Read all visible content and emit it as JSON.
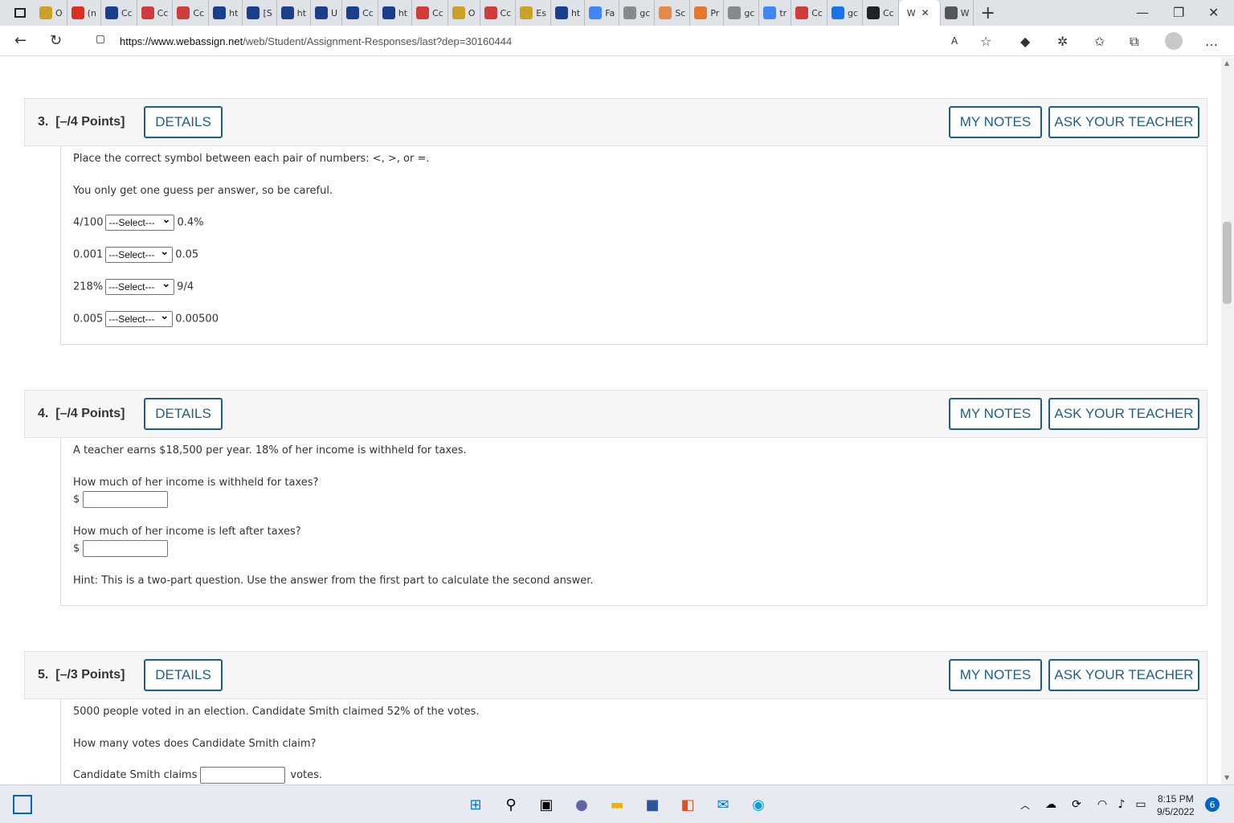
{
  "browser": {
    "tabs": [
      {
        "short": "O",
        "icon": "yellow-circle-icon",
        "color": "#c9a227"
      },
      {
        "short": "(n",
        "icon": "gmail-icon",
        "color": "#d93025"
      },
      {
        "short": "Cc",
        "icon": "star-icon",
        "color": "#1a3f8c"
      },
      {
        "short": "Cc",
        "icon": "pdf-icon",
        "color": "#d03c3c"
      },
      {
        "short": "Cc",
        "icon": "pdf-icon",
        "color": "#d03c3c"
      },
      {
        "short": "ht",
        "icon": "star-icon",
        "color": "#1a3f8c"
      },
      {
        "short": "[S",
        "icon": "star-icon",
        "color": "#1a3f8c"
      },
      {
        "short": "ht",
        "icon": "star-icon",
        "color": "#1a3f8c"
      },
      {
        "short": "U",
        "icon": "star-icon",
        "color": "#1a3f8c"
      },
      {
        "short": "Cc",
        "icon": "star-icon",
        "color": "#1a3f8c"
      },
      {
        "short": "ht",
        "icon": "star-icon",
        "color": "#1a3f8c"
      },
      {
        "short": "Cc",
        "icon": "pdf-icon",
        "color": "#d03c3c"
      },
      {
        "short": "O",
        "icon": "yellow-circle-icon",
        "color": "#c9a227"
      },
      {
        "short": "Cc",
        "icon": "pdf-icon",
        "color": "#d03c3c"
      },
      {
        "short": "Es",
        "icon": "yellow-circle-icon",
        "color": "#c9a227"
      },
      {
        "short": "ht",
        "icon": "star-icon",
        "color": "#1a3f8c"
      },
      {
        "short": "Fa",
        "icon": "doc-icon",
        "color": "#4285f4"
      },
      {
        "short": "gc",
        "icon": "search-icon",
        "color": "#888888"
      },
      {
        "short": "Sc",
        "icon": "c-icon",
        "color": "#e08a4c"
      },
      {
        "short": "Pr",
        "icon": "face-icon",
        "color": "#e8772e"
      },
      {
        "short": "gc",
        "icon": "search-icon",
        "color": "#888888"
      },
      {
        "short": "tr",
        "icon": "google-icon",
        "color": "#4285f4"
      },
      {
        "short": "Cc",
        "icon": "pdf-icon",
        "color": "#d03c3c"
      },
      {
        "short": "gc",
        "icon": "search-icon",
        "color": "#1a73e8"
      },
      {
        "short": "Cc",
        "icon": "bb-icon",
        "color": "#222222"
      },
      {
        "short": "W",
        "icon": "close-icon",
        "color": "#333333",
        "active": true
      },
      {
        "short": "W",
        "icon": "page-icon",
        "color": "#555555"
      }
    ],
    "url_host": "https://www.webassign.net",
    "url_path": "/web/Student/Assignment-Responses/last?dep=30160444"
  },
  "questions": [
    {
      "number": "3.",
      "points": "[–/4 Points]",
      "details": "DETAILS",
      "my_notes": "MY NOTES",
      "ask_teacher": "ASK YOUR TEACHER",
      "intro": "Place the correct symbol between each pair of numbers: <, >, or =.",
      "note": "You only get one guess per answer, so be careful.",
      "pairs": [
        {
          "left": "4/100",
          "select": "---Select---",
          "right": "0.4%"
        },
        {
          "left": "0.001",
          "select": "---Select---",
          "right": "0.05"
        },
        {
          "left": "218%",
          "select": "---Select---",
          "right": "9/4"
        },
        {
          "left": "0.005",
          "select": "---Select---",
          "right": "0.00500"
        }
      ]
    },
    {
      "number": "4.",
      "points": "[–/4 Points]",
      "details": "DETAILS",
      "my_notes": "MY NOTES",
      "ask_teacher": "ASK YOUR TEACHER",
      "intro": "A teacher earns $18,500 per year. 18% of her income is withheld for taxes.",
      "q1": "How much of her income is withheld for taxes?",
      "q2": "How much of her income is left after taxes?",
      "currency": "$",
      "hint": "Hint: This is a two-part question. Use the answer from the first part to calculate the second answer."
    },
    {
      "number": "5.",
      "points": "[–/3 Points]",
      "details": "DETAILS",
      "my_notes": "MY NOTES",
      "ask_teacher": "ASK YOUR TEACHER",
      "intro": "5000 people voted in an election. Candidate Smith claimed 52% of the votes.",
      "q1": "How many votes does Candidate Smith claim?",
      "answer_prefix": "Candidate Smith claims",
      "answer_suffix": "votes."
    }
  ],
  "taskbar": {
    "time": "8:15 PM",
    "date": "9/5/2022",
    "notifications": "6"
  }
}
